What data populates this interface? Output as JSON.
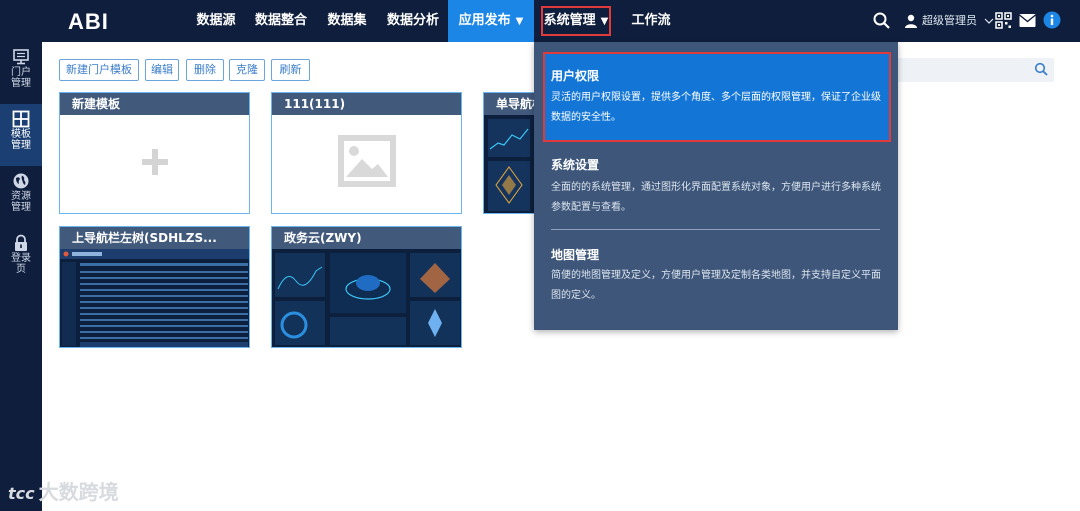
{
  "app": {
    "logo": "ABI"
  },
  "nav": {
    "items": [
      {
        "label": "数据源"
      },
      {
        "label": "数据整合"
      },
      {
        "label": "数据集"
      },
      {
        "label": "数据分析"
      },
      {
        "label": "应用发布",
        "caret": "▼"
      },
      {
        "label": "系统管理",
        "caret": "▼"
      },
      {
        "label": "工作流"
      }
    ],
    "user": "超级管理员"
  },
  "sidebar": {
    "items": [
      {
        "label": "门户管理",
        "icon": "monitor-icon"
      },
      {
        "label": "模板管理",
        "icon": "grid-icon"
      },
      {
        "label": "资源管理",
        "icon": "globe-icon"
      },
      {
        "label": "登录页",
        "icon": "lock-icon"
      }
    ]
  },
  "toolbar": {
    "buttons": [
      {
        "label": "新建门户模板"
      },
      {
        "label": "编辑"
      },
      {
        "label": "删除"
      },
      {
        "label": "克隆"
      },
      {
        "label": "刷新"
      }
    ]
  },
  "cards": [
    {
      "title": "新建模板"
    },
    {
      "title": "111(111)"
    },
    {
      "title": "单导航栏"
    },
    {
      "title": "上导航栏左树(SDHLZS..."
    },
    {
      "title": "政务云(ZWY)"
    }
  ],
  "dropdown": {
    "items": [
      {
        "title": "用户权限",
        "desc": "灵活的用户权限设置，提供多个角度、多个层面的权限管理，保证了企业级数据的安全性。"
      },
      {
        "title": "系统设置",
        "desc": "全面的的系统管理，通过图形化界面配置系统对象，方便用户进行多种系统参数配置与查看。"
      },
      {
        "title": "地图管理",
        "desc": "简便的地图管理及定义，方便用户管理及定制各类地图，并支持自定义平面图的定义。"
      }
    ]
  },
  "watermark": {
    "logo": "tcc",
    "text": "大数跨境"
  },
  "colors": {
    "topbar": "#0f1e3c",
    "accent": "#1b86e6",
    "highlight": "#e03a3a",
    "dropdown": "#3d5679"
  }
}
